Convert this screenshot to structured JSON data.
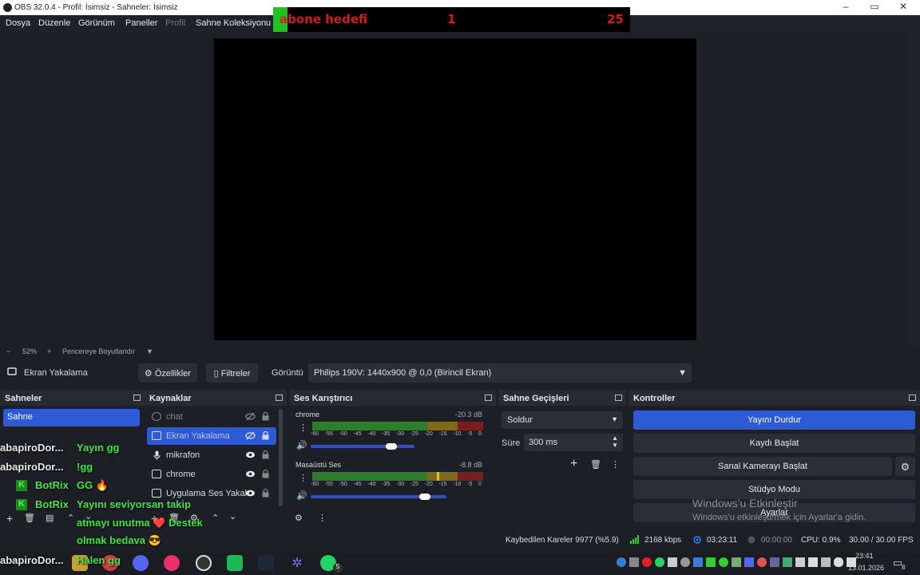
{
  "window": {
    "title": "OBS 32.0.4 - Profil: İsimsiz - Sahneler: İsimsiz",
    "controls": [
      "minimize",
      "maximize",
      "close"
    ]
  },
  "menu": {
    "items": [
      "Dosya",
      "Düzenle",
      "Görünüm",
      "Paneller",
      "Profil",
      "Sahne Koleksiyonu"
    ]
  },
  "overlay": {
    "goal_label": "abone hedefi",
    "current": "1",
    "target": "25"
  },
  "zoom": {
    "minus": "−",
    "percent": "52%",
    "plus": "+",
    "mode": "Pencereye Boyutlandır"
  },
  "sourcebar": {
    "selected_source": "Ekran Yakalama",
    "properties": "Özellikler",
    "filters": "Filtreler",
    "display_label": "Görüntü",
    "display_value": "Philips 190V: 1440x900 @ 0,0 (Birincil Ekran)"
  },
  "docks": {
    "scenes": {
      "title": "Sahneler",
      "items": [
        "Sahne"
      ]
    },
    "sources": {
      "title": "Kaynaklar",
      "items": [
        {
          "label": "chat",
          "icon": "browser-icon",
          "state": "hidden"
        },
        {
          "label": "Ekran Yakalama",
          "icon": "monitor-icon",
          "state": "hidden"
        },
        {
          "label": "mikrafon",
          "icon": "mic-icon",
          "state": "visible"
        },
        {
          "label": "chrome",
          "icon": "window-icon",
          "state": "visible"
        },
        {
          "label": "Uygulama Ses Yakal",
          "icon": "window-icon",
          "state": "visible"
        }
      ]
    },
    "mixer": {
      "title": "Ses Karıştırıcı",
      "channels": [
        {
          "name": "chrome",
          "db": "-20.3 dB"
        },
        {
          "name": "Masaüstü Ses",
          "db": "-8.8 dB"
        }
      ],
      "ticks": [
        "-60",
        "-55",
        "-50",
        "-45",
        "-40",
        "-35",
        "-30",
        "-25",
        "-20",
        "-15",
        "-10",
        "-5",
        "0"
      ]
    },
    "transitions": {
      "title": "Sahne Geçişleri",
      "transition": "Soldur",
      "duration_label": "Süre",
      "duration_value": "300 ms"
    },
    "controls": {
      "title": "Kontroller",
      "buttons": [
        "Yayını Durdur",
        "Kaydı Başlat",
        "Sanal Kamerayı Başlat",
        "Stüdyo Modu",
        "Ayarlar"
      ]
    }
  },
  "watermark": {
    "line1": "Windows'u Etkinleştir",
    "line2": "Windows'u etkinleştirmek için Ayarlar'a gidin."
  },
  "status": {
    "dropped": "Kaybedilen Kareler 9977 (%5.9)",
    "bitrate": "2168 kbps",
    "stream_time": "03:23:11",
    "rec_time": "00:00:00",
    "cpu": "CPU: 0.9%",
    "fps": "30.00 / 30.00 FPS"
  },
  "chat_overlay": {
    "messages": [
      {
        "user": "abapiroDor...",
        "text": "Yayın gg"
      },
      {
        "user": "abapiroDor...",
        "text": "!gg"
      },
      {
        "user": "BotRix",
        "text": "GG 🔥"
      },
      {
        "user": "BotRix",
        "text": "Yayını seviyorsan takip"
      },
      {
        "user": "",
        "text": "atmayı unutma ❤️ Destek"
      },
      {
        "user": "",
        "text": "olmak bedava 😎"
      },
      {
        "user": "abapiroDor...",
        "text": "Halen gg"
      }
    ]
  },
  "taskbar": {
    "time": "23:41",
    "date": "13.01.2026",
    "notification_count": "8",
    "whatsapp_badge": "5"
  },
  "colors": {
    "accent": "#2f5ad6",
    "meter_green": "#2e7d2e",
    "meter_yellow": "#7d6a1c",
    "meter_red": "#7a1d1d",
    "overlay_red": "#d51a1a",
    "chat_green": "#45e445"
  }
}
